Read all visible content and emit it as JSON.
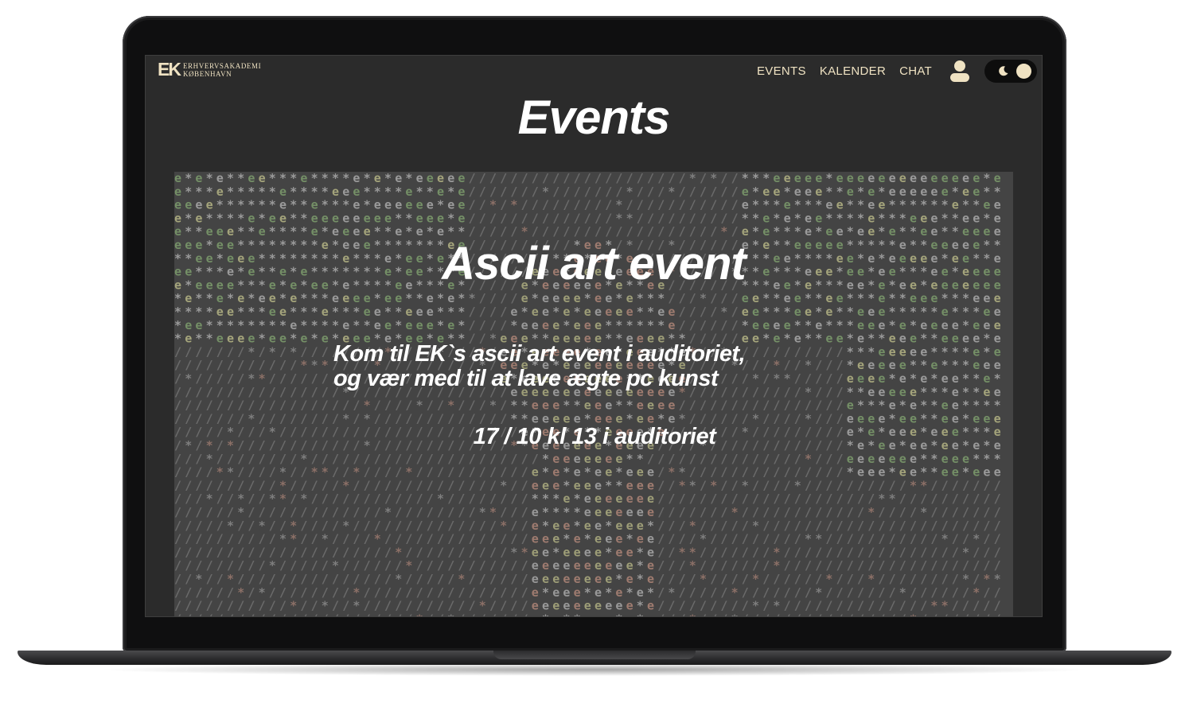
{
  "logo": {
    "mark": "EK",
    "line1": "ERHVERVSAKADEMI",
    "line2": "KØBENHAVN"
  },
  "nav": {
    "items": [
      {
        "label": "EVENTS"
      },
      {
        "label": "KALENDER"
      },
      {
        "label": "CHAT"
      }
    ],
    "user_icon": "user-icon",
    "theme_toggle": {
      "icon": "moon-icon",
      "state": "dark"
    }
  },
  "page": {
    "title": "Events"
  },
  "event": {
    "title": "Ascii art event",
    "description_line1": "Kom til EK`s ascii art event i auditoriet,",
    "description_line2": "og vær med til at lave ægte pc kunst",
    "date": "17 / 10 kl 13 i auditoriet"
  },
  "colors": {
    "screen_bg": "#2b2b2b",
    "accent": "#efe2c2",
    "hero_bg": "#464646",
    "ascii_green": "#8fb87a",
    "ascii_pink": "#d9a08e",
    "ascii_yellow": "#d8d89a"
  }
}
